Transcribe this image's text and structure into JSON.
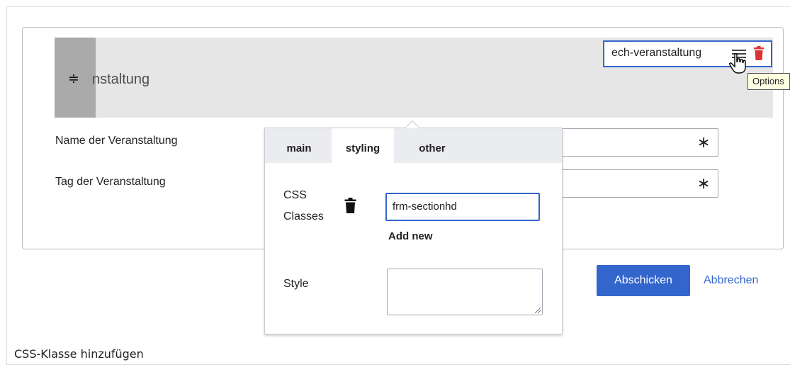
{
  "section": {
    "title_partial": "nstaltung",
    "toolbar_label": "ech-veranstaltung",
    "tooltip": "Options"
  },
  "fields": [
    {
      "label": "Name der Veranstaltung",
      "required": "∗"
    },
    {
      "label": "Tag der Veranstaltung",
      "required": "∗"
    }
  ],
  "popup": {
    "tabs": [
      "main",
      "styling",
      "other"
    ],
    "active_tab": "styling",
    "css_label_line1": "CSS",
    "css_label_line2": "Classes",
    "css_value": "frm-sectionhd",
    "add_new": "Add new",
    "style_label": "Style"
  },
  "buttons": {
    "submit": "Abschicken",
    "cancel": "Abbrechen"
  },
  "caption": "CSS-Klasse hinzufügen",
  "colors": {
    "accent": "#3366cc",
    "delete_red": "#d33",
    "header_bg": "#e6e6e6"
  }
}
